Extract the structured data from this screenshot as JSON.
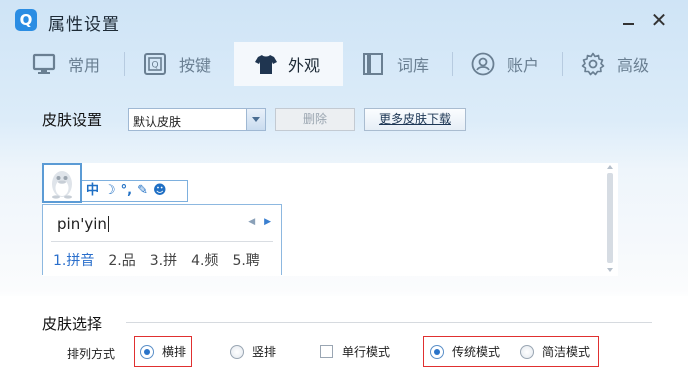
{
  "window": {
    "title": "属性设置",
    "logo_letter": "Q"
  },
  "controls": {
    "minimize": "−",
    "close": "✕"
  },
  "tabs": [
    {
      "label": "常用",
      "icon": "monitor-icon"
    },
    {
      "label": "按键",
      "icon": "key-icon"
    },
    {
      "label": "外观",
      "icon": "tshirt-icon",
      "active": true
    },
    {
      "label": "词库",
      "icon": "book-icon"
    },
    {
      "label": "账户",
      "icon": "user-icon"
    },
    {
      "label": "高级",
      "icon": "gear-icon"
    }
  ],
  "skin_settings": {
    "label": "皮肤设置",
    "selected_skin": "默认皮肤",
    "delete_label": "删除",
    "more_label": "更多皮肤下载"
  },
  "preview": {
    "toolbar": {
      "lang": "中",
      "moon": "☽",
      "punct": "°,",
      "tool": "✎",
      "palette": "☻"
    },
    "input": "pin'yin",
    "nav_prev": "◀",
    "nav_next": "▶",
    "candidates": [
      "1.拼音",
      "2.品",
      "3.拼",
      "4.频",
      "5.聘"
    ]
  },
  "skin_choose": {
    "label": "皮肤选择",
    "arrange_label": "排列方式",
    "options": {
      "horizontal": {
        "label": "横排",
        "checked": true
      },
      "vertical": {
        "label": "竖排",
        "checked": false
      },
      "single_line": {
        "label": "单行模式",
        "checked": false
      },
      "traditional": {
        "label": "传统模式",
        "checked": true
      },
      "simple": {
        "label": "简洁模式",
        "checked": false
      }
    }
  },
  "colors": {
    "accent": "#2b8de3",
    "highlight_box": "#e03030",
    "active_candidate": "#2a6fcc"
  }
}
